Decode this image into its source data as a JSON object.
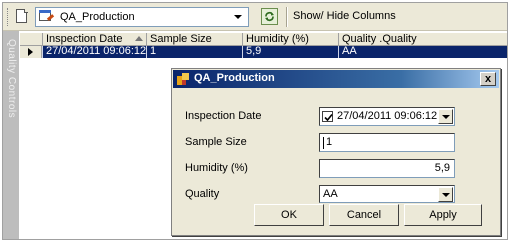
{
  "toolbar": {
    "table_select": {
      "value": "QA_Production",
      "icon": "table-edit-icon"
    },
    "refresh_icon": "refresh-icon",
    "show_hide_label": "Show/ Hide Columns"
  },
  "sidetab": {
    "label": "Quality Controls"
  },
  "grid": {
    "columns": [
      "Inspection Date",
      "Sample Size",
      "Humidity (%)",
      "Quality .Quality"
    ],
    "rows": [
      {
        "values": [
          "27/04/2011 09:06:12",
          "1",
          "5,9",
          "AA"
        ],
        "selected": true
      }
    ]
  },
  "dialog": {
    "title": "QA_Production",
    "close_glyph": "x",
    "fields": {
      "inspection_date": {
        "label": "Inspection Date",
        "value": "27/04/2011 09:06:12",
        "checked": true
      },
      "sample_size": {
        "label": "Sample Size",
        "value": "1"
      },
      "humidity": {
        "label": "Humidity (%)",
        "value": "5,9"
      },
      "quality": {
        "label": "Quality",
        "value": "AA"
      }
    },
    "buttons": {
      "ok": "OK",
      "cancel": "Cancel",
      "apply": "Apply"
    }
  },
  "colors": {
    "selection": "#0a246a",
    "titlebar_start": "#0a246a",
    "titlebar_end": "#a6caf0",
    "chrome": "#ece9d8",
    "sidetab": "#bdbdbd"
  }
}
